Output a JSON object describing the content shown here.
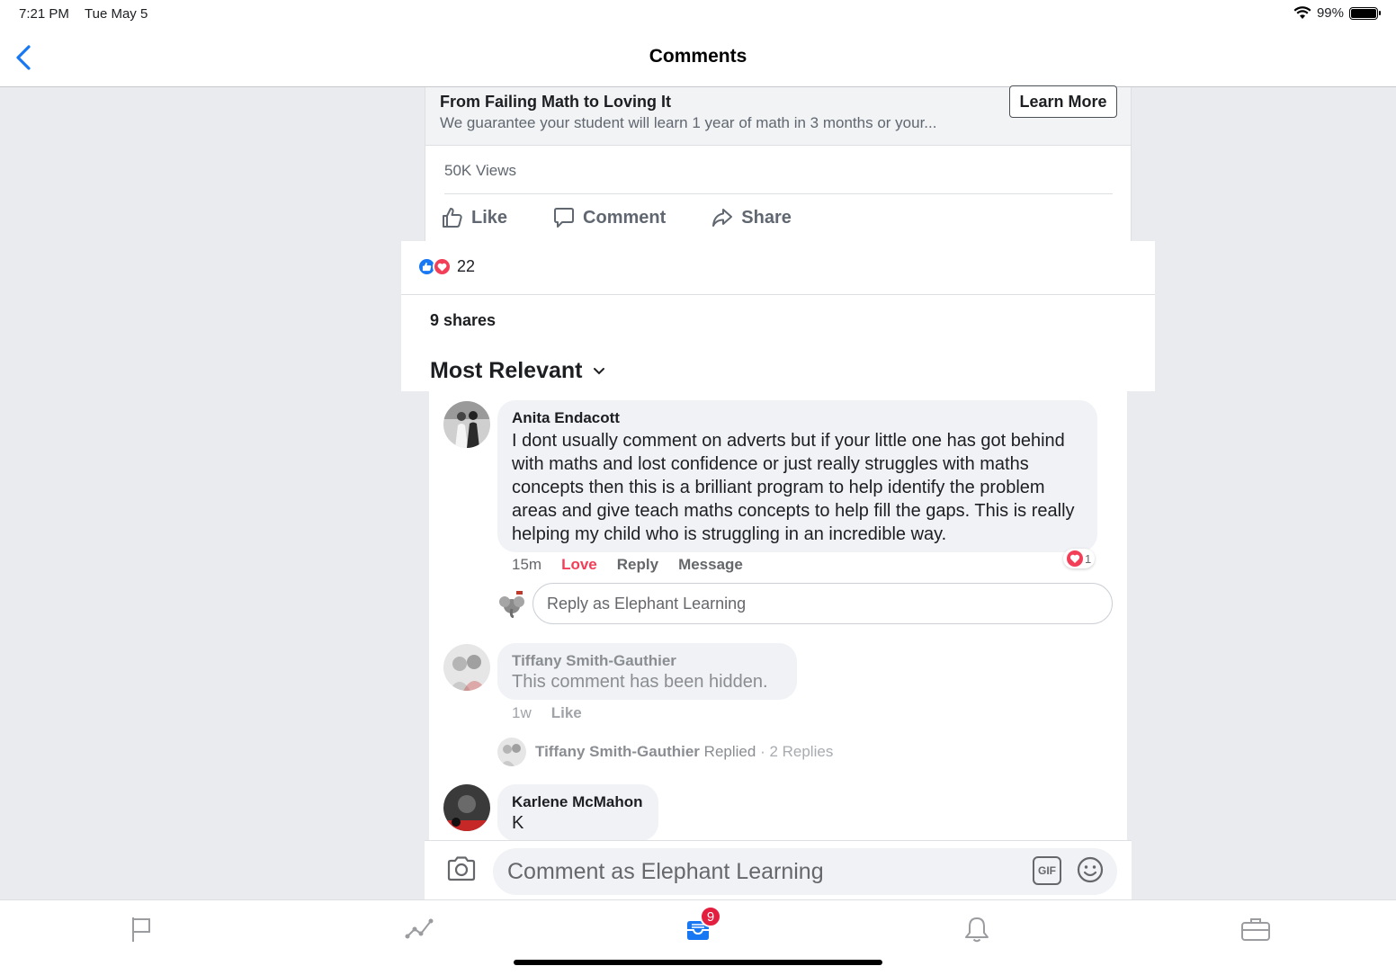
{
  "status_bar": {
    "time": "7:21 PM",
    "date": "Tue May 5",
    "battery": "99%"
  },
  "nav": {
    "title": "Comments"
  },
  "ad": {
    "title": "From Failing Math to Loving It",
    "description": "We guarantee your student will learn 1 year of math in 3 months or your...",
    "cta": "Learn More"
  },
  "post": {
    "views": "50K Views",
    "actions": {
      "like": "Like",
      "comment": "Comment",
      "share": "Share"
    },
    "reaction_count": "22",
    "shares": "9 shares",
    "sort_label": "Most Relevant"
  },
  "comments": [
    {
      "author": "Anita Endacott",
      "text": "I dont usually comment  on adverts but if your little one has got behind with maths and lost confidence or just really struggles with maths concepts then this is a brilliant program to help identify the problem areas and give teach maths concepts to help fill the gaps. This is really helping my child who is struggling in an incredible way.",
      "time": "15m",
      "reaction_action": "Love",
      "reply": "Reply",
      "message": "Message",
      "reaction_count": "1",
      "reply_placeholder": "Reply as Elephant Learning"
    },
    {
      "author": "Tiffany Smith-Gauthier",
      "text": "This comment has been hidden.",
      "time": "1w",
      "like": "Like",
      "replied_author": "Tiffany Smith-Gauthier",
      "replied_label": "Replied",
      "replies": "· 2 Replies"
    },
    {
      "author": "Karlene McMahon",
      "text": "K"
    }
  ],
  "composer": {
    "placeholder": "Comment as Elephant Learning",
    "gif": "GIF"
  },
  "tab_bar": {
    "inbox_badge": "9"
  },
  "colors": {
    "accent": "#1877f2",
    "love": "#f33e58",
    "badge": "#e41e3f"
  }
}
